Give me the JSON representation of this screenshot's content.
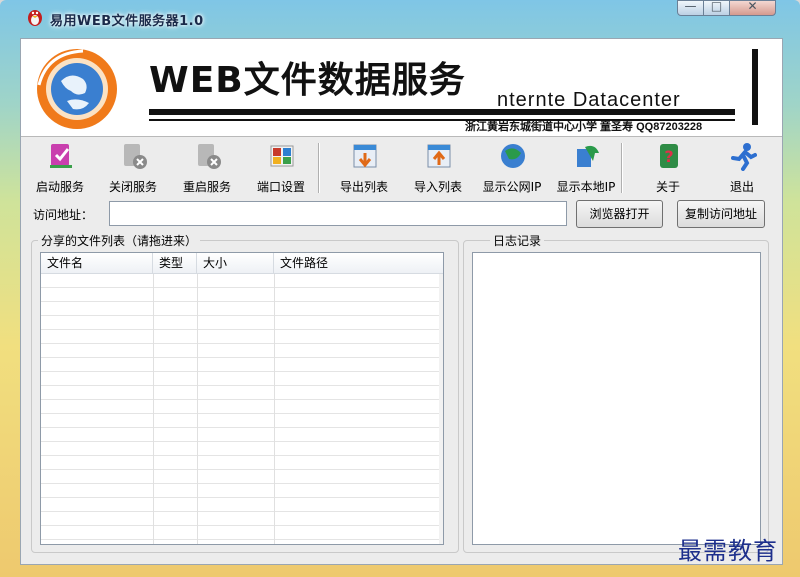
{
  "window": {
    "title": "易用WEB文件服务器1.0",
    "buttons": {
      "minimize": "—",
      "maximize": "□",
      "close": "✕"
    }
  },
  "banner": {
    "title": "WEB文件数据服务",
    "subtitle": "nternte  Datacenter",
    "credit": "浙江黄岩东城街道中心小学  童圣寿  QQ87203228"
  },
  "toolbar": [
    {
      "label": "启动服务",
      "icon": "start-service-icon",
      "color": "#c93fae"
    },
    {
      "label": "关闭服务",
      "icon": "stop-service-icon",
      "color": "#8a8a8a"
    },
    {
      "label": "重启服务",
      "icon": "restart-service-icon",
      "color": "#8a8a8a"
    },
    {
      "label": "端口设置",
      "icon": "port-settings-icon",
      "color": "#c83a2a"
    },
    {
      "label": "导出列表",
      "icon": "export-list-icon",
      "color": "#3a8ad6"
    },
    {
      "label": "导入列表",
      "icon": "import-list-icon",
      "color": "#3a8ad6"
    },
    {
      "label": "显示公网IP",
      "icon": "public-ip-icon",
      "color": "#2a9a4a"
    },
    {
      "label": "显示本地IP",
      "icon": "local-ip-icon",
      "color": "#2a9a4a"
    },
    {
      "label": "关于",
      "icon": "about-icon",
      "color": "#2f8c46"
    },
    {
      "label": "退出",
      "icon": "exit-icon",
      "color": "#2d6fd0"
    }
  ],
  "address": {
    "label": "访问地址：",
    "value": "",
    "open_button": "浏览器打开",
    "copy_button": "复制访问地址"
  },
  "files": {
    "group_title": "分享的文件列表（请拖进来）",
    "columns": [
      "文件名",
      "类型",
      "大小",
      "文件路径"
    ]
  },
  "log": {
    "group_title": "日志记录"
  },
  "watermark": "最需教育"
}
